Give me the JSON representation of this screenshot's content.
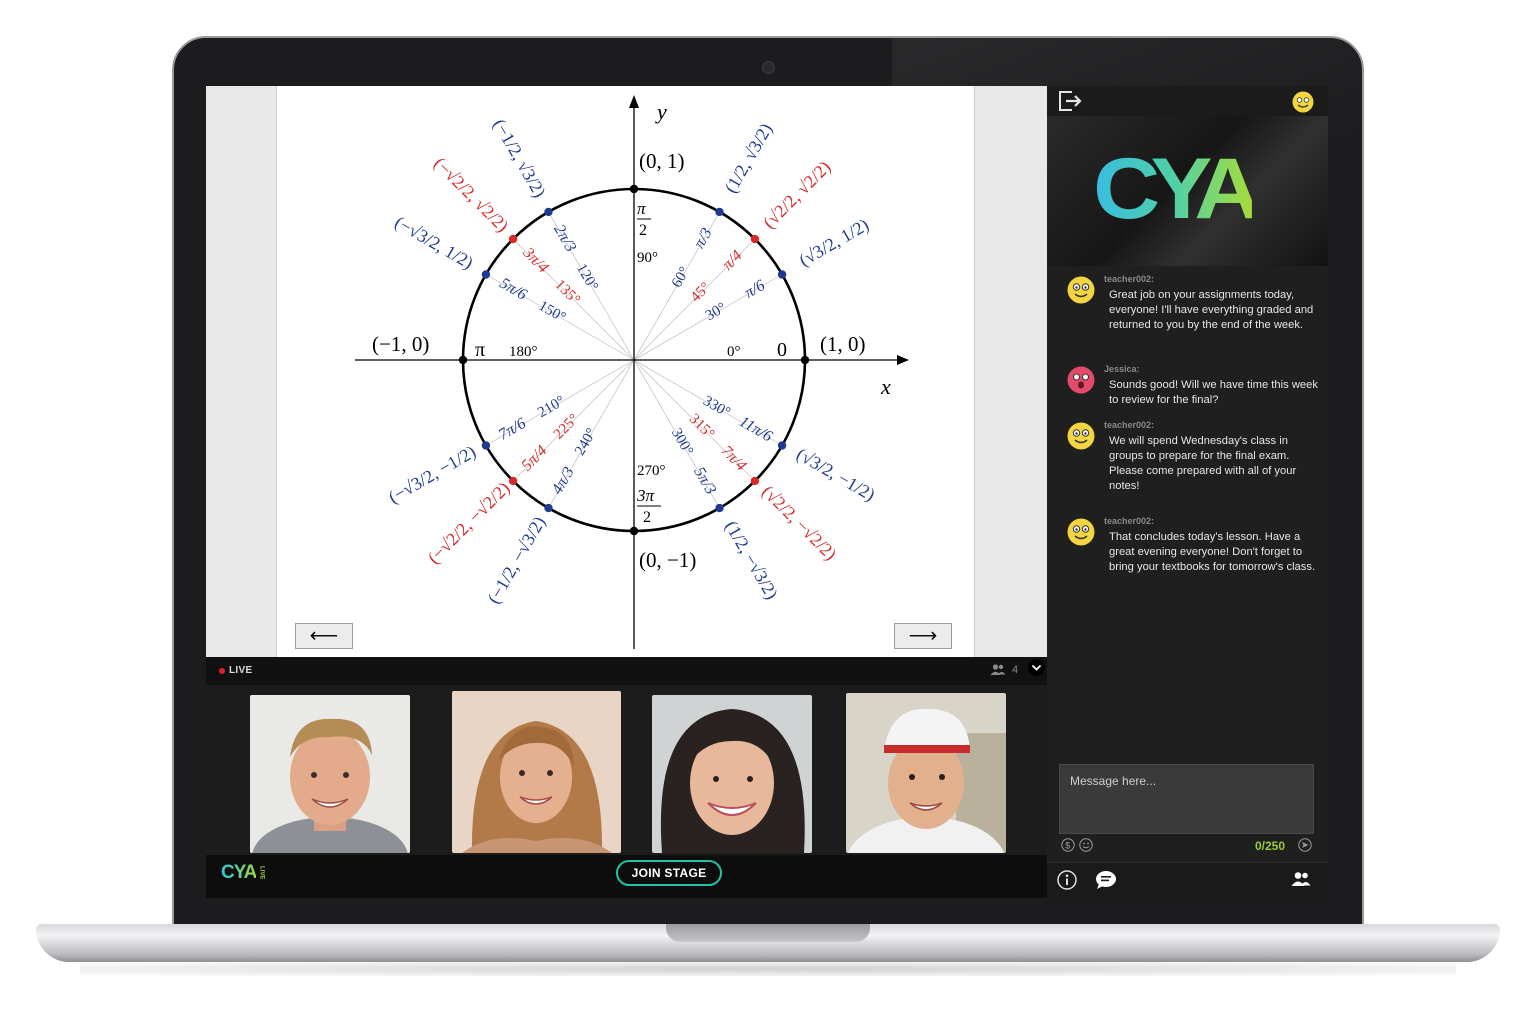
{
  "stage_bar": {
    "live_label": "LIVE",
    "viewer_count": "4"
  },
  "bottom_bar": {
    "logo_text": "CYA",
    "logo_sub": "LIVE",
    "join_label": "JOIN STAGE"
  },
  "slide": {
    "prev_arrow": "⟵",
    "next_arrow": "⟶",
    "axis_x": "x",
    "axis_y": "y",
    "point_top": "(0, 1)",
    "point_bottom": "(0, −1)",
    "point_left": "(−1, 0)",
    "point_right": "(1, 0)",
    "rad_0": "0",
    "rad_pi": "π",
    "deg_0": "0°",
    "deg_90": "90°",
    "deg_180": "180°",
    "deg_270": "270°",
    "rad_half_pi_num": "π",
    "rad_half_pi_den": "2",
    "rad_3half_pi_num": "3π",
    "rad_3half_pi_den": "2",
    "deg_30": "30°",
    "deg_45": "45°",
    "deg_60": "60°",
    "deg_120": "120°",
    "deg_135": "135°",
    "deg_150": "150°",
    "deg_210": "210°",
    "deg_225": "225°",
    "deg_240": "240°",
    "deg_300": "300°",
    "deg_315": "315°",
    "deg_330": "330°",
    "rad_30": "π/6",
    "rad_45": "π/4",
    "rad_60": "π/3",
    "rad_120": "2π/3",
    "rad_135": "3π/4",
    "rad_150": "5π/6",
    "rad_210": "7π/6",
    "rad_225": "5π/4",
    "rad_240": "4π/3",
    "rad_300": "5π/3",
    "rad_315": "7π/4",
    "rad_330": "11π/6",
    "coord_30": "(√3/2, 1/2)",
    "coord_45": "(√2/2, √2/2)",
    "coord_60": "(1/2, √3/2)",
    "coord_120": "(−1/2, √3/2)",
    "coord_135": "(−√2/2, √2/2)",
    "coord_150": "(−√3/2, 1/2)",
    "coord_210": "(−√3/2, −1/2)",
    "coord_225": "(−√2/2, −√2/2)",
    "coord_240": "(−1/2, −√3/2)",
    "coord_300": "(1/2, −√3/2)",
    "coord_315": "(√2/2, −√2/2)",
    "coord_330": "(√3/2, −1/2)"
  },
  "sidebar": {
    "banner_logo": "CYA",
    "messages": [
      {
        "user": "teacher002:",
        "text": "Great job on your assignments today, everyone! I'll have everything graded and returned to you by the end of the week."
      },
      {
        "user": "Jessica:",
        "text": "Sounds good! Will we have time this week to review for the final?"
      },
      {
        "user": "teacher002:",
        "text": "We will spend Wednesday's class in groups to prepare for the final exam. Please come prepared with all of your notes!"
      },
      {
        "user": "teacher002:",
        "text": "That concludes today's lesson. Have a great evening everyone! Don't forget to bring your textbooks for tomorrow's class."
      }
    ],
    "compose_placeholder": "Message here...",
    "char_counter": "0/250"
  },
  "colors": {
    "accent_teal": "#22c3a5",
    "accent_green": "#9acd32",
    "unit_circle_blue": "#1f3a8f",
    "unit_circle_red": "#d42a2a",
    "live_red": "#e02020"
  }
}
